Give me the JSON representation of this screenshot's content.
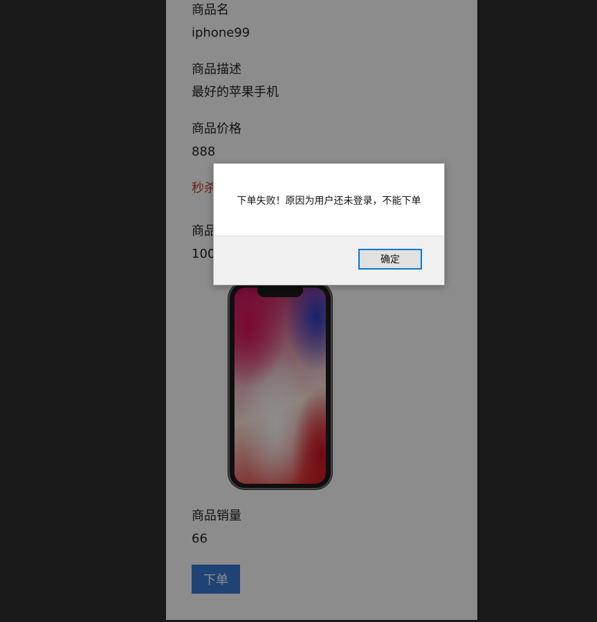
{
  "product": {
    "name_label": "商品名",
    "name_value": "iphone99",
    "desc_label": "商品描述",
    "desc_value": "最好的苹果手机",
    "price_label": "商品价格",
    "price_value": "888",
    "promo_text": "秒杀",
    "stock_label": "商品",
    "stock_value": "100",
    "sales_label": "商品销量",
    "sales_value": "66",
    "order_button": "下单"
  },
  "dialog": {
    "message": "下单失败！原因为用户还未登录，不能下单",
    "ok_label": "确定"
  },
  "colors": {
    "accent": "#3a7bd5",
    "promo": "#c0392b",
    "dialog_focus": "#0078d7"
  }
}
